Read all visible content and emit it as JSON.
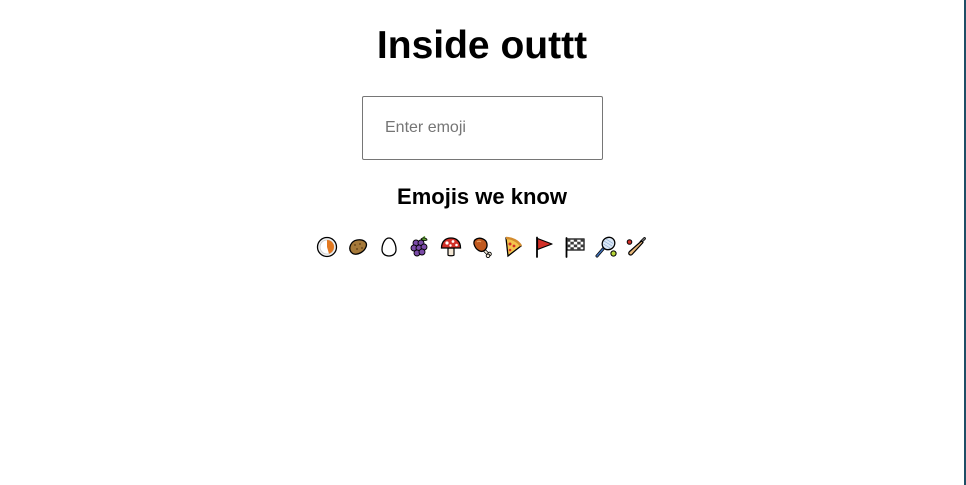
{
  "title": "Inside outtt",
  "search": {
    "placeholder": "Enter emoji",
    "value": ""
  },
  "known_heading": "Emojis we know",
  "emojis": [
    {
      "icon": "rice-cracker-icon",
      "char": "🍘"
    },
    {
      "icon": "potato-icon",
      "char": "🥔"
    },
    {
      "icon": "egg-icon",
      "char": "🥚"
    },
    {
      "icon": "grapes-icon",
      "char": "🍇"
    },
    {
      "icon": "mushroom-icon",
      "char": "🍄"
    },
    {
      "icon": "meat-on-bone-icon",
      "char": "🍖"
    },
    {
      "icon": "pizza-icon",
      "char": "🍕"
    },
    {
      "icon": "triangular-flag-icon",
      "char": "🚩"
    },
    {
      "icon": "chequered-flag-icon",
      "char": "🏁"
    },
    {
      "icon": "tennis-racket-icon",
      "char": "🎾"
    },
    {
      "icon": "cricket-bat-icon",
      "char": "🏏"
    }
  ]
}
